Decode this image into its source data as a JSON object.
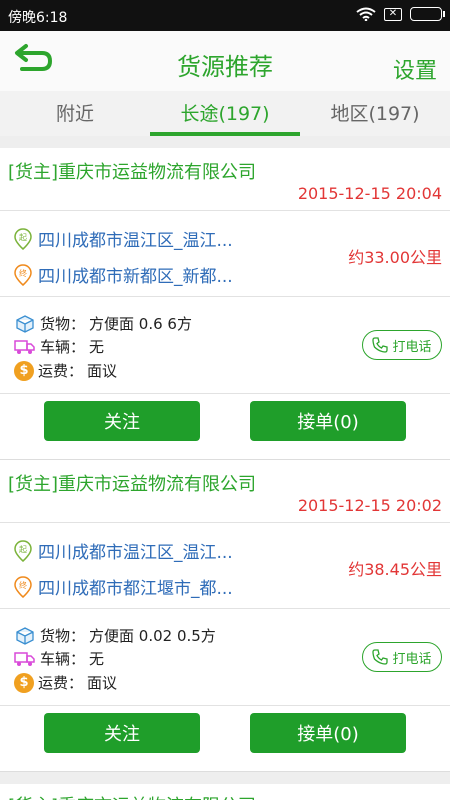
{
  "status_bar": {
    "time": "傍晚6:18",
    "sim_label": "✕"
  },
  "header": {
    "title": "货源推荐",
    "settings": "设置"
  },
  "tabs": [
    "附近",
    "长途(197)",
    "地区(197)"
  ],
  "colors": {
    "brand_green": "#2da52d",
    "button_green": "#1f9e2a",
    "alert_red": "#e23636",
    "route_blue": "#2f6cb8"
  },
  "labels": {
    "cargo": "货物：",
    "vehicle": "车辆：",
    "fee": "运费：",
    "call": "打电话",
    "follow": "关注",
    "accept": "接单(0)"
  },
  "icons": {
    "back": "back-arrow-icon",
    "origin": "origin-pin-icon",
    "dest": "destination-pin-icon",
    "cargo": "box-icon",
    "vehicle": "truck-icon",
    "fee": "coin-icon",
    "phone": "phone-icon"
  },
  "listings": [
    {
      "company": "[货主]重庆市运益物流有限公司",
      "date": "2015-12-15 20:04",
      "from": "四川成都市温江区_温江...",
      "to": "四川成都市新都区_新都...",
      "distance": "约33.00公里",
      "cargo": "方便面  0.6  6方",
      "vehicle": "无",
      "fee": "面议"
    },
    {
      "company": "[货主]重庆市运益物流有限公司",
      "date": "2015-12-15 20:02",
      "from": "四川成都市温江区_温江...",
      "to": "四川成都市都江堰市_都...",
      "distance": "约38.45公里",
      "cargo": "方便面  0.02  0.5方",
      "vehicle": "无",
      "fee": "面议"
    },
    {
      "company": "[货主]重庆市运益物流有限公司"
    }
  ]
}
